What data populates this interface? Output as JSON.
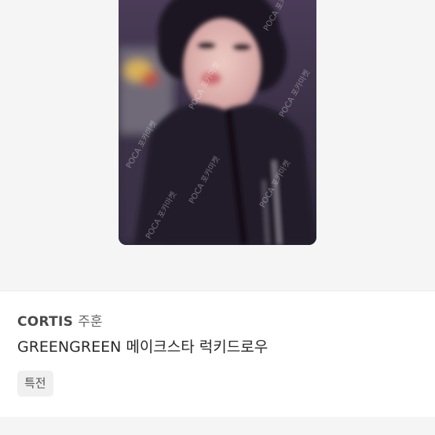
{
  "product": {
    "image": {
      "watermark": "POCA 포카마켓"
    },
    "group": "CORTIS",
    "member": "주훈",
    "title": "GREENGREEN 메이크스타 럭키드로우",
    "badge": "특전"
  },
  "colors": {
    "image_background": "#f5f5f5",
    "card_dark": "#221c2d",
    "badge_background": "#f0f0f0"
  }
}
